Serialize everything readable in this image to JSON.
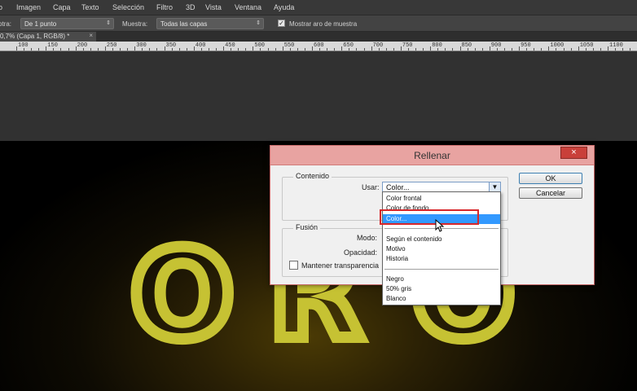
{
  "menubar": {
    "items": [
      "o",
      "Imagen",
      "Capa",
      "Texto",
      "Selección",
      "Filtro",
      "3D",
      "Vista",
      "Ventana",
      "Ayuda"
    ]
  },
  "options": {
    "tra_label": "otra:",
    "tra_value": "De 1 punto",
    "muestra_label": "Muestra:",
    "muestra_value": "Todas las capas",
    "ring_label": "Mostrar aro de muestra",
    "ring_checked": true
  },
  "document_tab": {
    "label": "0,7% (Capa 1, RGB/8) *",
    "close": "×"
  },
  "ruler": {
    "labels": [
      "100",
      "150",
      "200",
      "250",
      "300",
      "350",
      "400",
      "450",
      "500",
      "550",
      "600",
      "650",
      "700",
      "750",
      "800",
      "850",
      "900",
      "950",
      "1000",
      "1050",
      "1100",
      "1150"
    ]
  },
  "canvas": {
    "text": [
      "O",
      "R",
      "O"
    ],
    "color": "#c6c233"
  },
  "dialog": {
    "title": "Rellenar",
    "close": "×",
    "contenido_label": "Contenido",
    "usar_label": "Usar:",
    "usar_value": "Color...",
    "fusion_label": "Fusión",
    "modo_label": "Modo:",
    "opacidad_label": "Opacidad:",
    "transparency_label": "Mantener transparencia",
    "ok_label": "OK",
    "cancel_label": "Cancelar"
  },
  "dropdown": {
    "options": [
      "Color frontal",
      "Color de fondo",
      "Color...",
      "Según el contenido",
      "Motivo",
      "Historia",
      "Negro",
      "50% gris",
      "Blanco"
    ],
    "selected": "Color..."
  },
  "colors": {
    "highlight": "#3399ff",
    "annotation": "#d8262a",
    "title_bar": "#e8a3a1"
  }
}
